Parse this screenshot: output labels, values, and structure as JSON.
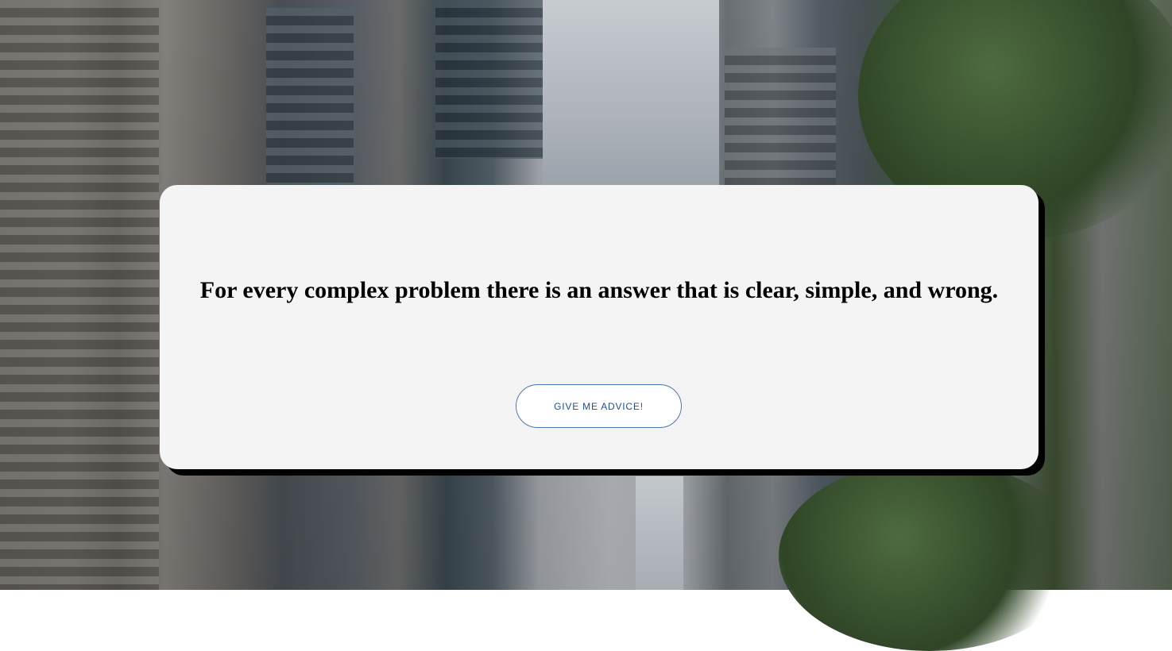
{
  "advice": {
    "quote": "For every complex problem there is an answer that is clear, simple, and wrong."
  },
  "button": {
    "label": "GIVE ME ADVICE!"
  },
  "colors": {
    "card_background": "#f4f4f4",
    "card_shadow": "#000000",
    "button_border": "#4a78b5",
    "button_text": "#1f4f8f"
  }
}
